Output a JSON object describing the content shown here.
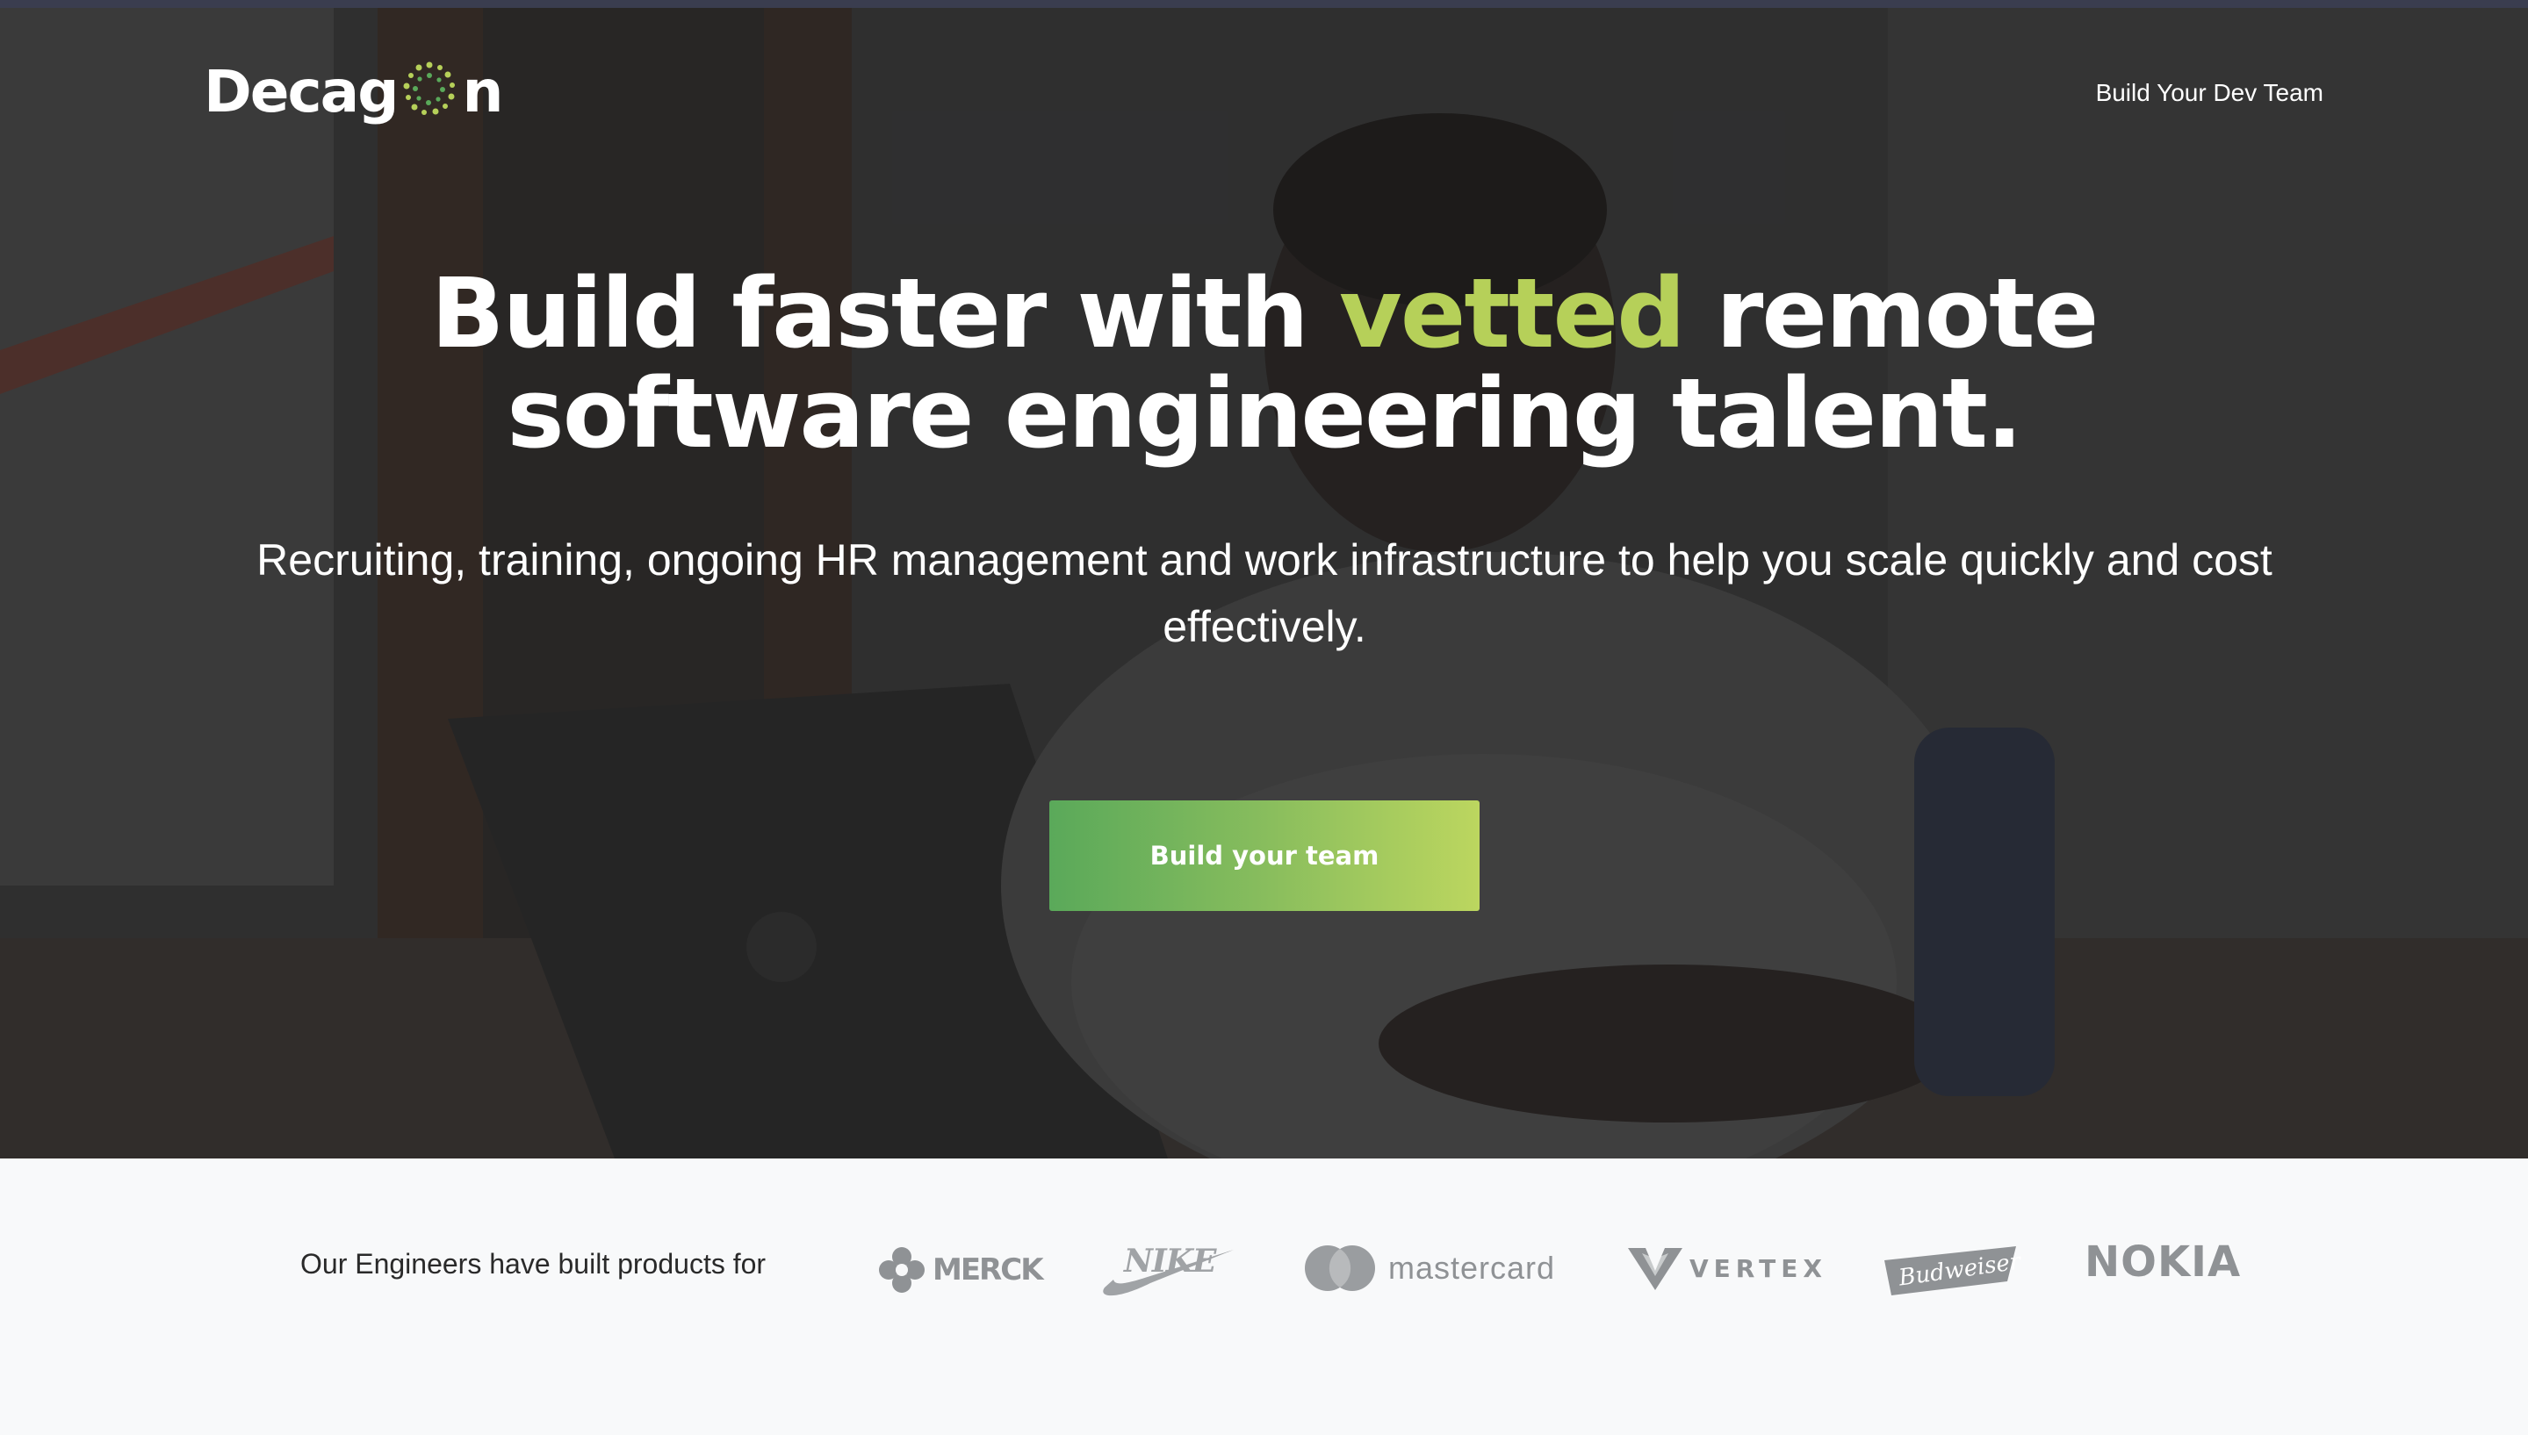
{
  "header": {
    "logo_text_left": "Decag",
    "logo_text_right": "n",
    "logo_icon": "dotted-ring-logo-icon",
    "nav_link_label": "Build Your Dev Team"
  },
  "hero": {
    "headline_part1": "Build faster with ",
    "headline_accent": "vetted",
    "headline_part2": " remote",
    "headline_line2": "software engineering talent.",
    "subheadline": "Recruiting, training, ongoing HR management and work infrastructure to help you scale quickly and cost effectively.",
    "cta_label": "Build your team"
  },
  "clients": {
    "label": "Our Engineers have built products for",
    "logos": [
      {
        "name": "MERCK",
        "icon": "merck-logo"
      },
      {
        "name": "NIKE",
        "icon": "nike-swoosh-logo"
      },
      {
        "name": "mastercard",
        "icon": "mastercard-circles-logo"
      },
      {
        "name": "VERTEX",
        "icon": "vertex-logo"
      },
      {
        "name": "Budweiser",
        "icon": "budweiser-bowtie-logo"
      },
      {
        "name": "NOKIA",
        "icon": "nokia-logo"
      }
    ]
  },
  "colors": {
    "accent_green": "#b6d059",
    "cta_gradient_start": "#5aa95a",
    "cta_gradient_end": "#bcd65f",
    "top_bar": "#3a3d4f",
    "clients_bg": "#f8f9fa",
    "brand_gray": "#8f9295"
  }
}
